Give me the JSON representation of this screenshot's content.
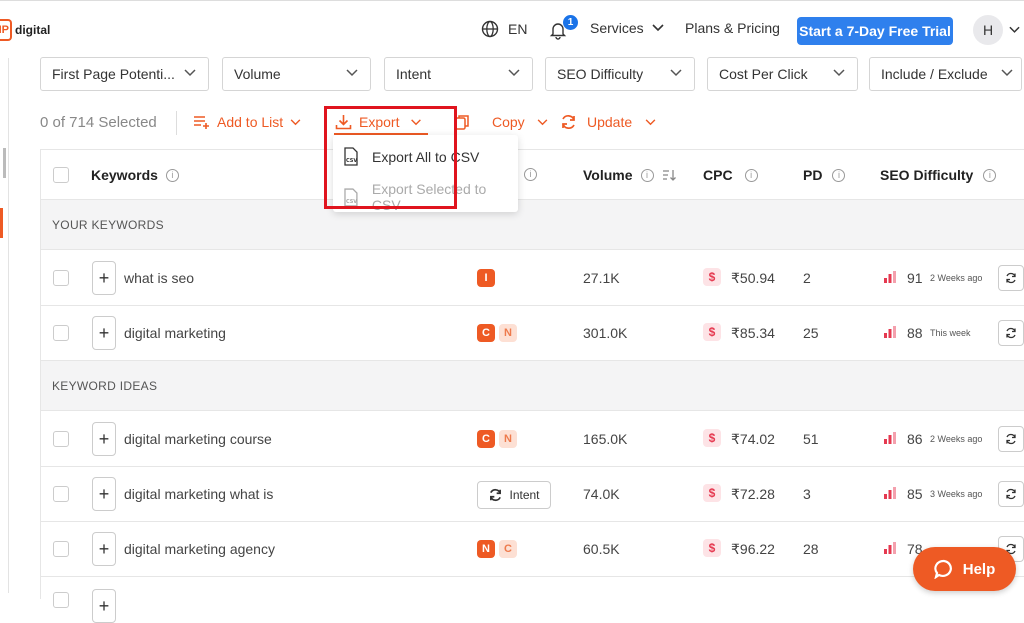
{
  "header": {
    "logo_mark": "IP",
    "logo_name": "digital",
    "language": "EN",
    "notification_count": "1",
    "services": "Services",
    "plans": "Plans & Pricing",
    "trial_button": "Start a 7-Day Free Trial",
    "avatar_initial": "H"
  },
  "filters": [
    {
      "label": "First Page Potenti..."
    },
    {
      "label": "Volume"
    },
    {
      "label": "Intent"
    },
    {
      "label": "SEO Difficulty"
    },
    {
      "label": "Cost Per Click"
    },
    {
      "label": "Include / Exclude"
    }
  ],
  "toolbar": {
    "selected_text": "0 of 714 Selected",
    "add_to_list": "Add to List",
    "export": "Export",
    "copy": "Copy",
    "update": "Update"
  },
  "export_menu": {
    "all": "Export All to CSV",
    "selected": "Export Selected to CSV"
  },
  "table": {
    "headers": {
      "keywords": "Keywords",
      "volume": "Volume",
      "cpc": "CPC",
      "pd": "PD",
      "seo": "SEO Difficulty"
    },
    "section_your": "YOUR KEYWORDS",
    "section_ideas": "KEYWORD IDEAS",
    "rows": [
      {
        "keyword": "what is seo",
        "volume": "27.1K",
        "cpc": "₹50.94",
        "pd": "2",
        "sd": "91",
        "when": "2 Weeks ago"
      },
      {
        "keyword": "digital marketing",
        "volume": "301.0K",
        "cpc": "₹85.34",
        "pd": "25",
        "sd": "88",
        "when": "This week"
      },
      {
        "keyword": "digital marketing course",
        "volume": "165.0K",
        "cpc": "₹74.02",
        "pd": "51",
        "sd": "86",
        "when": "2 Weeks ago"
      },
      {
        "keyword": "digital marketing what is",
        "volume": "74.0K",
        "cpc": "₹72.28",
        "pd": "3",
        "sd": "85",
        "when": "3 Weeks ago",
        "intent_button": "Intent"
      },
      {
        "keyword": "digital marketing agency",
        "volume": "60.5K",
        "cpc": "₹96.22",
        "pd": "28",
        "sd": "78",
        "when": ""
      }
    ],
    "intent_labels": {
      "i": "I",
      "c": "C",
      "n": "N"
    },
    "currency_icon": "$"
  },
  "help_button": "Help",
  "colors": {
    "accent": "#ee5a24",
    "primary": "#2f80ed",
    "highlight": "#e0141e"
  }
}
